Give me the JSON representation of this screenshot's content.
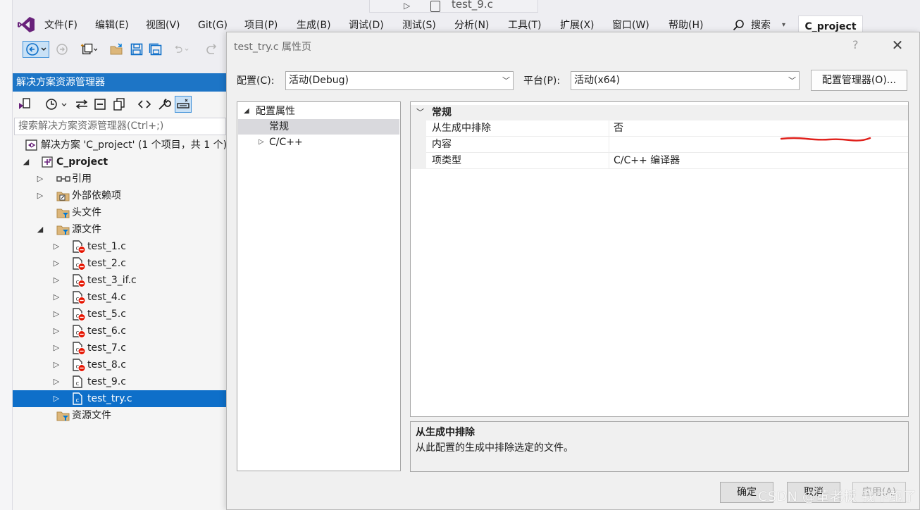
{
  "background_tab": {
    "label": "test_9.c"
  },
  "menubar": {
    "items": [
      "文件(F)",
      "编辑(E)",
      "视图(V)",
      "Git(G)",
      "项目(P)",
      "生成(B)",
      "调试(D)",
      "测试(S)",
      "分析(N)",
      "工具(T)",
      "扩展(X)",
      "窗口(W)",
      "帮助(H)"
    ],
    "search_label": "搜索",
    "project_name": "C_project"
  },
  "solution_explorer": {
    "title": "解决方案资源管理器",
    "search_placeholder": "搜索解决方案资源管理器(Ctrl+;)",
    "solution_label": "解决方案 'C_project' (1 个项目，共 1 个)",
    "project_label": "C_project",
    "nodes": {
      "references": "引用",
      "external_deps": "外部依赖项",
      "header_files": "头文件",
      "source_files": "源文件",
      "resource_files": "资源文件"
    },
    "files": [
      "test_1.c",
      "test_2.c",
      "test_3_if.c",
      "test_4.c",
      "test_5.c",
      "test_6.c",
      "test_7.c",
      "test_8.c",
      "test_9.c",
      "test_try.c"
    ],
    "excluded_files": [
      "test_1.c",
      "test_2.c",
      "test_3_if.c",
      "test_4.c",
      "test_5.c",
      "test_6.c",
      "test_7.c",
      "test_8.c"
    ],
    "selected_file": "test_try.c"
  },
  "dialog": {
    "title": "test_try.c 属性页",
    "help": "?",
    "close": "✕",
    "config_label": "配置(C):",
    "config_value": "活动(Debug)",
    "platform_label": "平台(P):",
    "platform_value": "活动(x64)",
    "config_manager": "配置管理器(O)...",
    "category_tree": {
      "root": "配置属性",
      "general": "常规",
      "cpp": "C/C++"
    },
    "property_grid": {
      "section": "常规",
      "rows": [
        {
          "name": "从生成中排除",
          "value": "否"
        },
        {
          "name": "内容",
          "value": ""
        },
        {
          "name": "项类型",
          "value": "C/C++ 编译器"
        }
      ]
    },
    "description": {
      "title": "从生成中排除",
      "text": "从此配置的生成中排除选定的文件。"
    },
    "buttons": {
      "ok": "确定",
      "cancel": "取消",
      "apply": "应用(A)"
    }
  },
  "watermark": "CSDN @董老板 我卞鲍了",
  "colors": {
    "accent": "#1d75c6",
    "selection": "#0e6fc9",
    "annotation_red": "#e0201b",
    "excluded_badge": "#e51400"
  }
}
